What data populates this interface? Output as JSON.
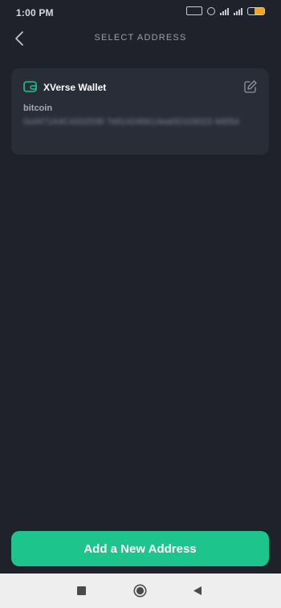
{
  "status_bar": {
    "time": "1:00 PM",
    "battery_color": "#f0a81a"
  },
  "header": {
    "title": "SELECT ADDRESS",
    "back_icon": "chevron-left-icon"
  },
  "address_card": {
    "wallet_name": "XVerse Wallet",
    "wallet_icon": "wallet-icon",
    "edit_icon": "edit-icon",
    "chain": "bitcoin",
    "address": "0x4471A4C4202538 7e614249A14ea0D103023 4d05d"
  },
  "actions": {
    "add_address_label": "Add a New Address",
    "accent_color": "#1dc48c"
  },
  "nav_bar": {
    "recents_icon": "square-icon",
    "home_icon": "circle-icon",
    "back_icon": "triangle-back-icon"
  }
}
